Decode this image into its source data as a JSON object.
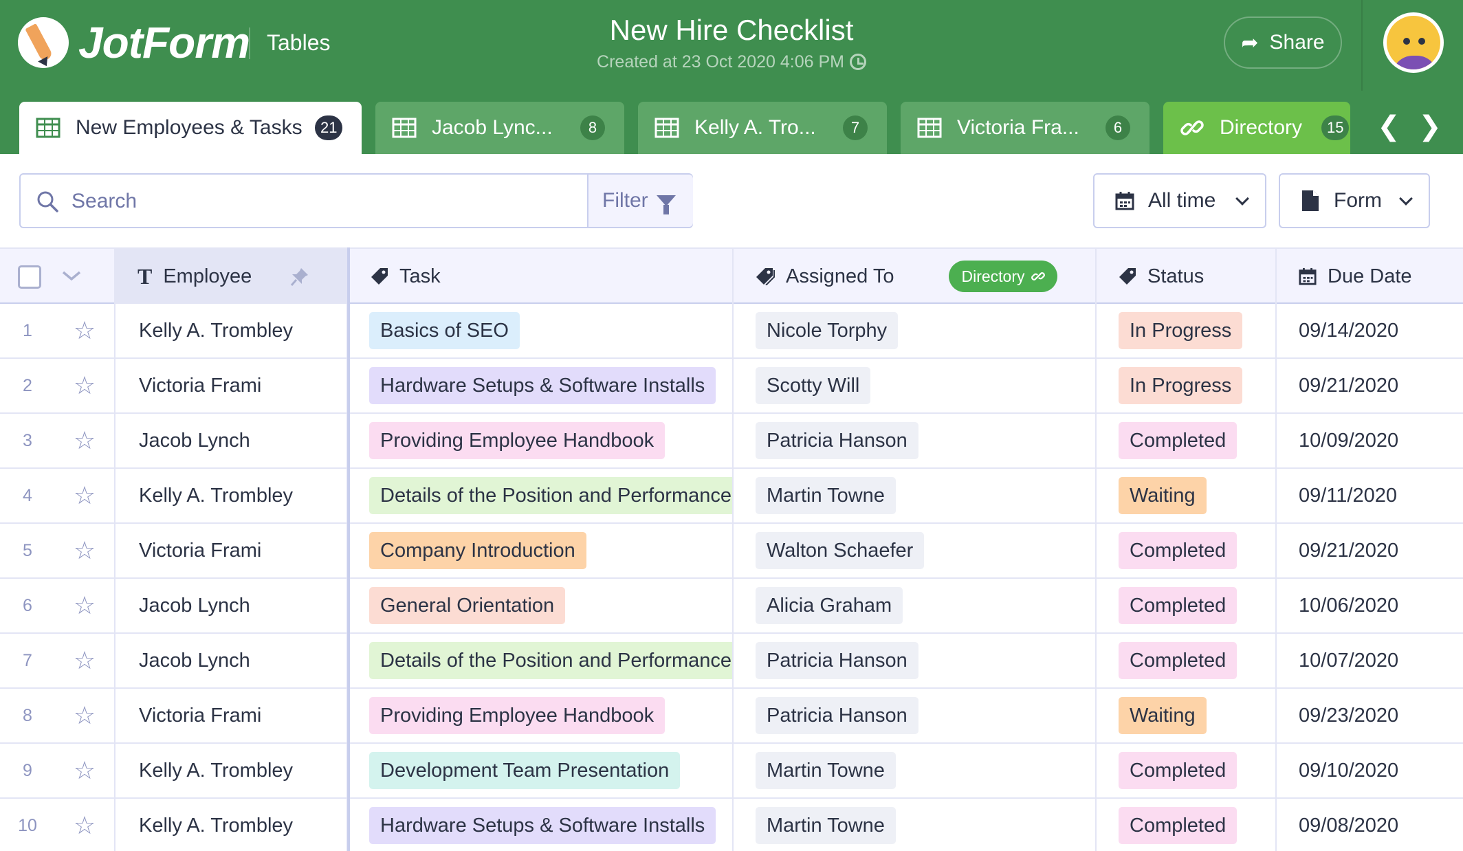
{
  "app": {
    "brand": "JotForm",
    "product": "Tables",
    "title": "New Hire Checklist",
    "created": "Created at 23 Oct 2020 4:06 PM",
    "share_label": "Share",
    "share_icon": "share-arrow-icon",
    "avatar_icon": "cat-avatar-icon"
  },
  "tabs": [
    {
      "label": "New Employees & Tasks",
      "count": "21",
      "icon": "table-grid-icon",
      "active": true
    },
    {
      "label": "Jacob Lync...",
      "count": "8",
      "icon": "table-grid-icon",
      "active": false
    },
    {
      "label": "Kelly A. Tro...",
      "count": "7",
      "icon": "table-grid-icon",
      "active": false
    },
    {
      "label": "Victoria Fra...",
      "count": "6",
      "icon": "table-grid-icon",
      "active": false
    },
    {
      "label": "Directory",
      "count": "15",
      "icon": "link-icon",
      "active": false
    }
  ],
  "toolbar": {
    "search_placeholder": "Search",
    "filter_label": "Filter",
    "time_label": "All time",
    "form_label": "Form"
  },
  "columns": {
    "employee": "Employee",
    "task": "Task",
    "assigned": "Assigned To",
    "assigned_badge": "Directory",
    "status": "Status",
    "due": "Due Date"
  },
  "colors": {
    "header_green": "#3f8e4f",
    "tab_inactive": "#5ea668",
    "tab_directory": "#6cc04a",
    "directory_badge": "#4caf50"
  },
  "rows": [
    {
      "num": "1",
      "employee": "Kelly A. Trombley",
      "task": "Basics of SEO",
      "task_color": "#dbeefc",
      "assigned": "Nicole Torphy",
      "status": "In Progress",
      "status_color": "#fcdcd3",
      "due": "09/14/2020"
    },
    {
      "num": "2",
      "employee": "Victoria Frami",
      "task": "Hardware Setups & Software Installs",
      "task_color": "#e2dcfb",
      "assigned": "Scotty Will",
      "status": "In Progress",
      "status_color": "#fcdcd3",
      "due": "09/21/2020"
    },
    {
      "num": "3",
      "employee": "Jacob Lynch",
      "task": "Providing Employee Handbook",
      "task_color": "#fbdcf1",
      "assigned": "Patricia Hanson",
      "status": "Completed",
      "status_color": "#fbdcf1",
      "due": "10/09/2020"
    },
    {
      "num": "4",
      "employee": "Kelly A. Trombley",
      "task": "Details of the Position and Performance",
      "task_color": "#e1f5d5",
      "assigned": "Martin Towne",
      "status": "Waiting",
      "status_color": "#fdd3a8",
      "due": "09/11/2020"
    },
    {
      "num": "5",
      "employee": "Victoria Frami",
      "task": "Company Introduction",
      "task_color": "#fdd3a8",
      "assigned": "Walton Schaefer",
      "status": "Completed",
      "status_color": "#fbdcf1",
      "due": "09/21/2020"
    },
    {
      "num": "6",
      "employee": "Jacob Lynch",
      "task": "General Orientation",
      "task_color": "#fcdcd3",
      "assigned": "Alicia Graham",
      "status": "Completed",
      "status_color": "#fbdcf1",
      "due": "10/06/2020"
    },
    {
      "num": "7",
      "employee": "Jacob Lynch",
      "task": "Details of the Position and Performance",
      "task_color": "#e1f5d5",
      "assigned": "Patricia Hanson",
      "status": "Completed",
      "status_color": "#fbdcf1",
      "due": "10/07/2020"
    },
    {
      "num": "8",
      "employee": "Victoria Frami",
      "task": "Providing Employee Handbook",
      "task_color": "#fbdcf1",
      "assigned": "Patricia Hanson",
      "status": "Waiting",
      "status_color": "#fdd3a8",
      "due": "09/23/2020"
    },
    {
      "num": "9",
      "employee": "Kelly A. Trombley",
      "task": "Development Team Presentation",
      "task_color": "#d4f3ee",
      "assigned": "Martin Towne",
      "status": "Completed",
      "status_color": "#fbdcf1",
      "due": "09/10/2020"
    },
    {
      "num": "10",
      "employee": "Kelly A. Trombley",
      "task": "Hardware Setups & Software Installs",
      "task_color": "#e2dcfb",
      "assigned": "Martin Towne",
      "status": "Completed",
      "status_color": "#fbdcf1",
      "due": "09/08/2020"
    }
  ]
}
